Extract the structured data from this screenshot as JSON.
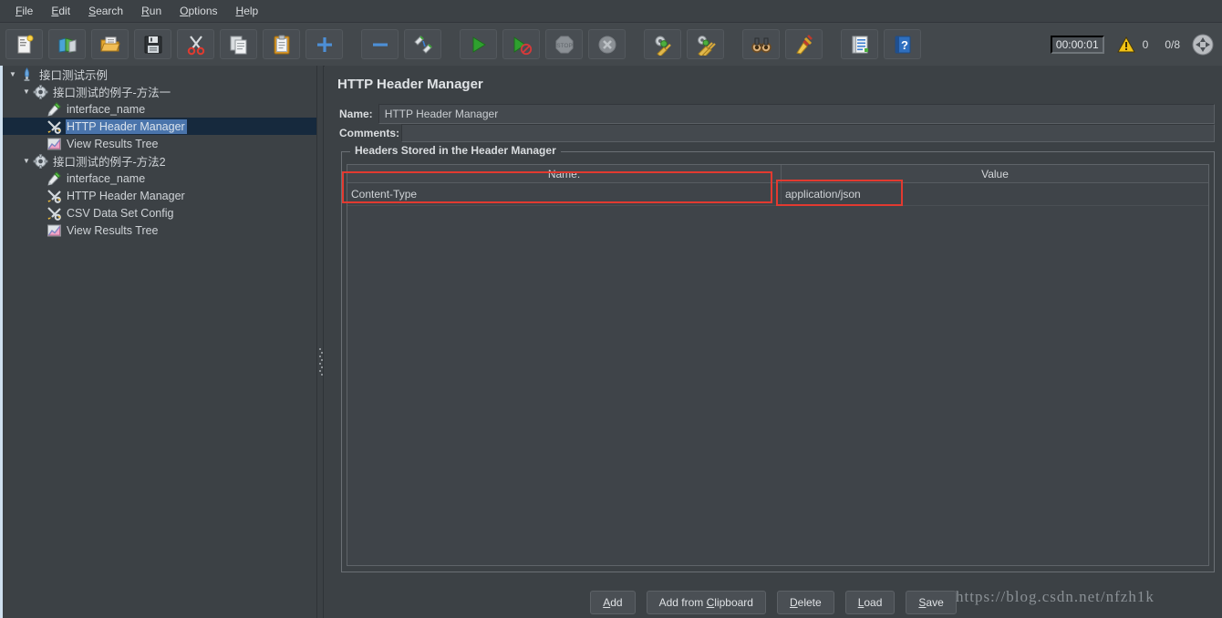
{
  "menubar": {
    "items": [
      {
        "pre": "",
        "mn": "F",
        "post": "ile"
      },
      {
        "pre": "",
        "mn": "E",
        "post": "dit"
      },
      {
        "pre": "",
        "mn": "S",
        "post": "earch"
      },
      {
        "pre": "",
        "mn": "R",
        "post": "un"
      },
      {
        "pre": "",
        "mn": "O",
        "post": "ptions"
      },
      {
        "pre": "",
        "mn": "H",
        "post": "elp"
      }
    ]
  },
  "toolbar": {
    "buttons": [
      {
        "name": "new-button",
        "icon": "new-document-icon"
      },
      {
        "name": "templates-button",
        "icon": "templates-icon"
      },
      {
        "name": "open-button",
        "icon": "open-folder-icon"
      },
      {
        "name": "save-button",
        "icon": "save-floppy-icon"
      },
      {
        "name": "cut-button",
        "icon": "scissors-icon"
      },
      {
        "name": "copy-button",
        "icon": "copy-icon"
      },
      {
        "name": "paste-button",
        "icon": "clipboard-paste-icon"
      },
      {
        "name": "expand-button",
        "icon": "plus-icon"
      },
      {
        "name": "collapse-button",
        "icon": "minus-icon"
      },
      {
        "name": "toggle-button",
        "icon": "toggle-icon"
      },
      {
        "name": "start-button",
        "icon": "play-green-icon"
      },
      {
        "name": "start-no-pauses-button",
        "icon": "play-no-pauses-icon"
      },
      {
        "name": "stop-button",
        "icon": "stop-sign-icon"
      },
      {
        "name": "shutdown-button",
        "icon": "shutdown-x-icon"
      },
      {
        "name": "clear-button",
        "icon": "gear-broom-icon"
      },
      {
        "name": "clear-all-button",
        "icon": "gear-broom-all-icon"
      },
      {
        "name": "search-button",
        "icon": "binoculars-icon"
      },
      {
        "name": "reset-search-button",
        "icon": "yellow-broom-icon"
      },
      {
        "name": "function-helper-button",
        "icon": "function-helper-icon"
      },
      {
        "name": "help-button",
        "icon": "help-book-icon"
      }
    ],
    "timer": "00:00:01",
    "warning_count": "0",
    "thread_count": "0/8",
    "connection_icon": "connection-circle-icon"
  },
  "tree": {
    "nodes": [
      {
        "depth": 0,
        "twisty": "▼",
        "icon": "jmeter-feather-icon",
        "label": "接口测试示例",
        "selected": false,
        "name": "tree-node-test-plan"
      },
      {
        "depth": 1,
        "twisty": "▼",
        "icon": "thread-group-gear-icon",
        "label": "接口测试的例子-方法一",
        "selected": false,
        "name": "tree-node-thread-group-1"
      },
      {
        "depth": 2,
        "twisty": "",
        "icon": "sampler-pen-icon",
        "label": "interface_name",
        "selected": false,
        "name": "tree-node-sampler-1"
      },
      {
        "depth": 2,
        "twisty": "",
        "icon": "config-wrench-icon",
        "label": "HTTP Header Manager",
        "selected": true,
        "name": "tree-node-header-manager-1"
      },
      {
        "depth": 2,
        "twisty": "",
        "icon": "listener-chart-icon",
        "label": "View Results Tree",
        "selected": false,
        "name": "tree-node-view-results-1"
      },
      {
        "depth": 1,
        "twisty": "▼",
        "icon": "thread-group-gear-icon",
        "label": "接口测试的例子-方法2",
        "selected": false,
        "name": "tree-node-thread-group-2"
      },
      {
        "depth": 2,
        "twisty": "",
        "icon": "sampler-pen-icon",
        "label": "interface_name",
        "selected": false,
        "name": "tree-node-sampler-2"
      },
      {
        "depth": 2,
        "twisty": "",
        "icon": "config-wrench-icon",
        "label": "HTTP Header Manager",
        "selected": false,
        "name": "tree-node-header-manager-2"
      },
      {
        "depth": 2,
        "twisty": "",
        "icon": "config-wrench-icon",
        "label": "CSV Data Set Config",
        "selected": false,
        "name": "tree-node-csv-data-set"
      },
      {
        "depth": 2,
        "twisty": "",
        "icon": "listener-chart-icon",
        "label": "View Results Tree",
        "selected": false,
        "name": "tree-node-view-results-2"
      }
    ]
  },
  "panel": {
    "title": "HTTP Header Manager",
    "name_label": "Name:",
    "name_value": "HTTP Header Manager",
    "comments_label": "Comments:",
    "comments_value": "",
    "group_legend": "Headers Stored in the Header Manager",
    "columns": [
      "Name:",
      "Value"
    ],
    "rows": [
      {
        "name": "Content-Type",
        "value": "application/json"
      }
    ],
    "buttons": [
      {
        "pre": "",
        "mn": "A",
        "post": "dd",
        "name": "add-button"
      },
      {
        "pre": "Add from ",
        "mn": "C",
        "post": "lipboard",
        "name": "add-from-clipboard-button"
      },
      {
        "pre": "",
        "mn": "D",
        "post": "elete",
        "name": "delete-button"
      },
      {
        "pre": "",
        "mn": "L",
        "post": "oad",
        "name": "load-button"
      },
      {
        "pre": "",
        "mn": "S",
        "post": "ave",
        "name": "save-headers-button"
      }
    ]
  },
  "watermark": "https://blog.csdn.net/nfzh1k",
  "colors": {
    "background": "#3c4145",
    "toolbar": "#43484c",
    "selection": "#4a74ab",
    "selection_row": "#16293d",
    "annotation_red": "#e23a30",
    "text": "#d6d9dc"
  }
}
